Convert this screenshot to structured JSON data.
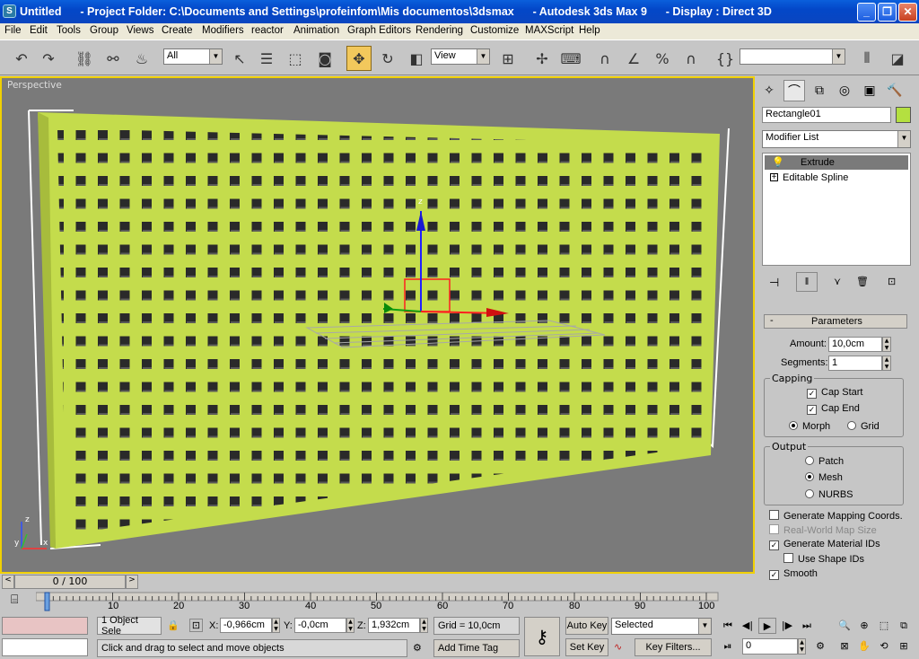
{
  "window": {
    "title": "Untitled      - Project Folder: C:\\Documents and Settings\\profeinfom\\Mis documentos\\3dsmax      - Autodesk 3ds Max 9      - Display : Direct 3D"
  },
  "menu": [
    "File",
    "Edit",
    "Tools",
    "Group",
    "Views",
    "Create",
    "Modifiers",
    "reactor",
    "Animation",
    "Graph Editors",
    "Rendering",
    "Customize",
    "MAXScript",
    "Help"
  ],
  "toolbar": {
    "selection_filter": "All",
    "reference_coord": "View",
    "named_selection": ""
  },
  "viewport": {
    "label": "Perspective",
    "axis_labels": {
      "z": "z",
      "x": "x",
      "y": "y"
    }
  },
  "command_panel": {
    "object_name": "Rectangle01",
    "object_color": "#b4e040",
    "modifier_list_label": "Modifier List",
    "stack": [
      {
        "name": "Extrude",
        "selected": true
      },
      {
        "name": "Editable Spline",
        "selected": false
      }
    ],
    "parameters": {
      "title": "Parameters",
      "amount_label": "Amount:",
      "amount": "10,0cm",
      "segments_label": "Segments:",
      "segments": "1",
      "capping_title": "Capping",
      "cap_start": "Cap Start",
      "cap_end": "Cap End",
      "morph": "Morph",
      "grid": "Grid",
      "output_title": "Output",
      "patch": "Patch",
      "mesh": "Mesh",
      "nurbs": "NURBS",
      "gen_mapping": "Generate Mapping Coords.",
      "real_world": "Real-World Map Size",
      "gen_material": "Generate Material IDs",
      "use_shape": "Use Shape IDs",
      "smooth": "Smooth"
    }
  },
  "timeline": {
    "frame_display": "0 / 100",
    "ticks": [
      "10",
      "20",
      "30",
      "40",
      "50",
      "60",
      "70",
      "80",
      "90",
      "100"
    ]
  },
  "status": {
    "selection_count": "1 Object Sele",
    "x_label": "X:",
    "x": "-0,966cm",
    "y_label": "Y:",
    "y": "-0,0cm",
    "z_label": "Z:",
    "z": "1,932cm",
    "grid": "Grid = 10,0cm",
    "prompt": "Click and drag to select and move objects",
    "add_time_tag": "Add Time Tag",
    "auto_key": "Auto Key",
    "set_key": "Set Key",
    "selected": "Selected",
    "key_filters": "Key Filters...",
    "current_frame": "0"
  },
  "colors": {
    "object": "#c4dc4c",
    "viewport_bg": "#7a7a7a",
    "active_border": "#f0d000"
  }
}
